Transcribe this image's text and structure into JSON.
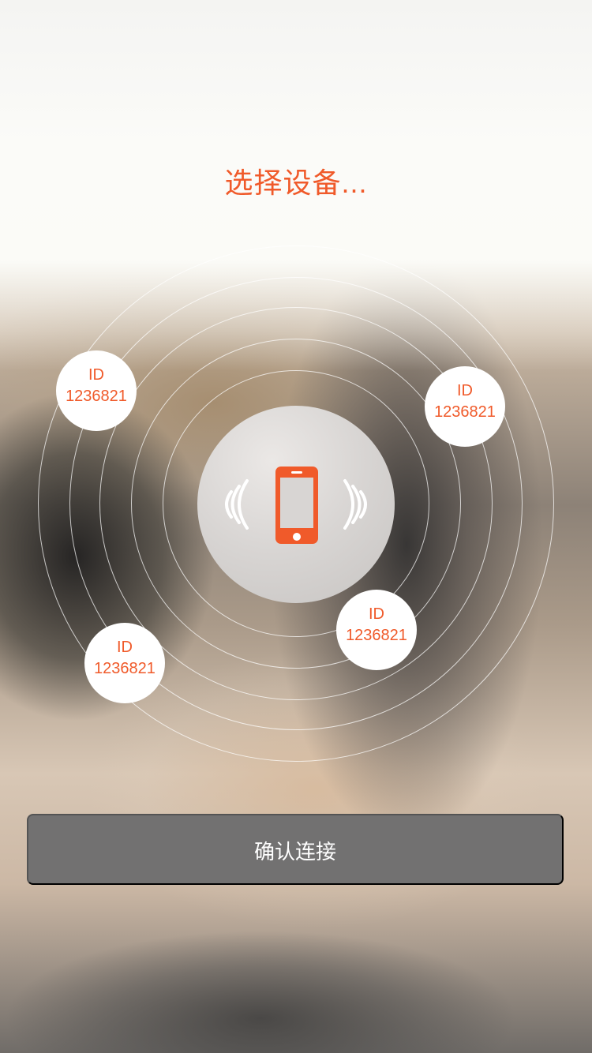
{
  "screen": {
    "title": "选择设备...",
    "accent_color": "#f05a2a",
    "center_icon": "phone-signal-icon",
    "devices": [
      {
        "id_label": "ID",
        "id_value": "1236821"
      },
      {
        "id_label": "ID",
        "id_value": "1236821"
      },
      {
        "id_label": "ID",
        "id_value": "1236821"
      },
      {
        "id_label": "ID",
        "id_value": "1236821"
      }
    ],
    "button_label": "确认连接",
    "button_color": "#727171"
  }
}
